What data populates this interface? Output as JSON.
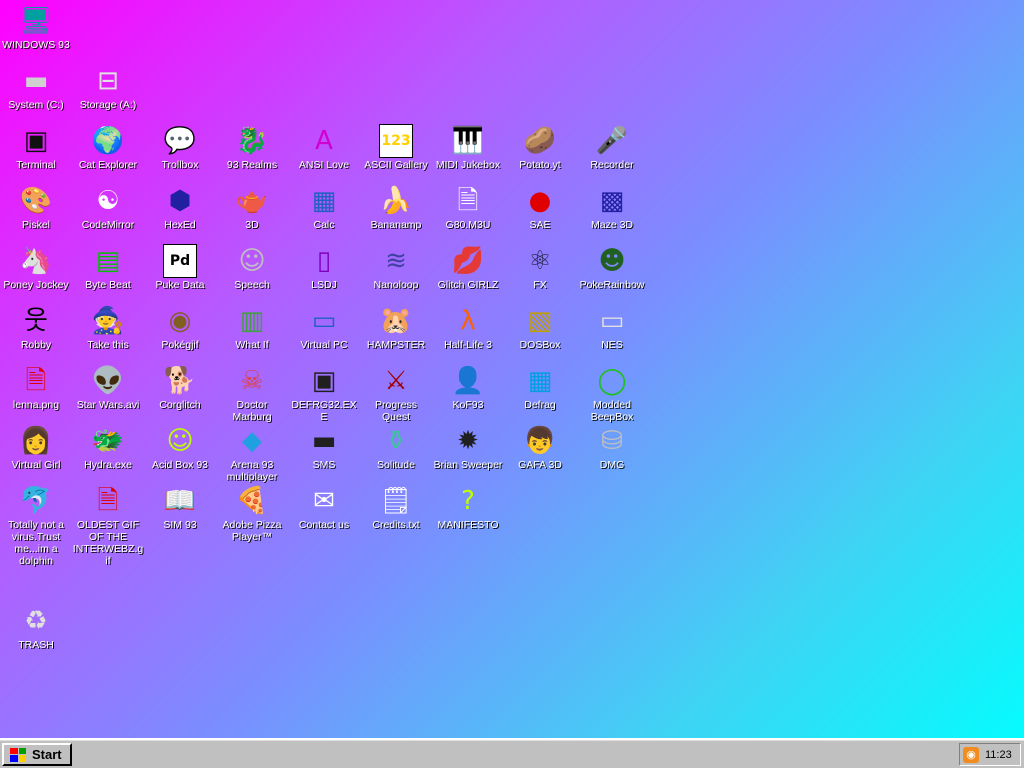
{
  "desktop": {
    "icons": [
      {
        "label": "WINDOWS 93",
        "icon": "computer-icon",
        "glyph": "🖥",
        "color": "#00a0a0"
      },
      {
        "label": "System (C:)",
        "icon": "hard-drive-icon",
        "glyph": "▬",
        "color": "#d0d0d0"
      },
      {
        "label": "Storage (A:)",
        "icon": "floppy-drive-icon",
        "glyph": "⊟",
        "color": "#e0e0e0"
      },
      {
        "label": "Terminal",
        "icon": "terminal-icon",
        "glyph": "▣",
        "color": "#111111"
      },
      {
        "label": "Cat Explorer",
        "icon": "cat-globe-icon",
        "glyph": "🌍",
        "color": "#3a8a3a"
      },
      {
        "label": "Trollbox",
        "icon": "chat-bubble-icon",
        "glyph": "💬",
        "color": "#2ab4ff"
      },
      {
        "label": "93 Realms",
        "icon": "dragon-icon",
        "glyph": "🐉",
        "color": "#d01010"
      },
      {
        "label": "ANSI Love",
        "icon": "ansi-letter-icon",
        "glyph": "A",
        "color": "#d000d0"
      },
      {
        "label": "ASCII Gallery",
        "icon": "number-blocks-icon",
        "glyph": "123",
        "color": "#ffd000"
      },
      {
        "label": "MIDI Jukebox",
        "icon": "piano-keys-icon",
        "glyph": "🎹",
        "color": "#222222"
      },
      {
        "label": "Potato.yt",
        "icon": "potato-icon",
        "glyph": "🥔",
        "color": "#b07030"
      },
      {
        "label": "Recorder",
        "icon": "microphone-icon",
        "glyph": "🎤",
        "color": "#333333"
      },
      {
        "label": "Piskel",
        "icon": "paint-palette-icon",
        "glyph": "🎨",
        "color": "#d0a050"
      },
      {
        "label": "CodeMirror",
        "icon": "code-mirror-icon",
        "glyph": "☯",
        "color": "#ffffff"
      },
      {
        "label": "HexEd",
        "icon": "hex-cube-icon",
        "glyph": "⬢",
        "color": "#2020a0"
      },
      {
        "label": "3D",
        "icon": "teapot-icon",
        "glyph": "🫖",
        "color": "#ff80a0"
      },
      {
        "label": "Calc",
        "icon": "calculator-icon",
        "glyph": "▦",
        "color": "#2060c0"
      },
      {
        "label": "Bananamp",
        "icon": "banana-icon",
        "glyph": "🍌",
        "color": "#ffe000"
      },
      {
        "label": "G80.M3U",
        "icon": "music-file-icon",
        "glyph": "🗎",
        "color": "#ffffff"
      },
      {
        "label": "SAE",
        "icon": "checkered-ball-icon",
        "glyph": "●",
        "color": "#e00000"
      },
      {
        "label": "Maze 3D",
        "icon": "maze-icon",
        "glyph": "▩",
        "color": "#2020a0"
      },
      {
        "label": "Poney Jockey",
        "icon": "pony-icon",
        "glyph": "🦄",
        "color": "#c080ff"
      },
      {
        "label": "Byte Beat",
        "icon": "waveform-icon",
        "glyph": "▤",
        "color": "#00c000"
      },
      {
        "label": "Puke Data",
        "icon": "pd-patch-icon",
        "glyph": "Pd",
        "color": "#000000"
      },
      {
        "label": "Speech",
        "icon": "face-speech-icon",
        "glyph": "☺",
        "color": "#c0c0c0"
      },
      {
        "label": "LSDJ",
        "icon": "gameboy-icon",
        "glyph": "▯",
        "color": "#8000c0"
      },
      {
        "label": "Nanoloop",
        "icon": "sine-wave-icon",
        "glyph": "≋",
        "color": "#4040a0"
      },
      {
        "label": "Glitch GIRLZ",
        "icon": "lips-icon",
        "glyph": "💋",
        "color": "#e00040"
      },
      {
        "label": "FX",
        "icon": "atom-icon",
        "glyph": "⚛",
        "color": "#202040"
      },
      {
        "label": "PokeRainbow",
        "icon": "pokemon-group-icon",
        "glyph": "☻",
        "color": "#206020"
      },
      {
        "label": "Robby",
        "icon": "stick-figure-icon",
        "glyph": "웃",
        "color": "#000000"
      },
      {
        "label": "Take this",
        "icon": "pixel-character-icon",
        "glyph": "🧙",
        "color": "#ff6000"
      },
      {
        "label": "Pokégjif",
        "icon": "pokemon-ball-icon",
        "glyph": "◉",
        "color": "#806020"
      },
      {
        "label": "What If",
        "icon": "film-strip-icon",
        "glyph": "▥",
        "color": "#40a040"
      },
      {
        "label": "Virtual PC",
        "icon": "virtual-pc-window-icon",
        "glyph": "▭",
        "color": "#2060c0"
      },
      {
        "label": "HAMPSTER",
        "icon": "hamster-icon",
        "glyph": "🐹",
        "color": "#f0f0f0"
      },
      {
        "label": "Half-Life 3",
        "icon": "lambda-icon",
        "glyph": "λ",
        "color": "#ff6000"
      },
      {
        "label": "DOSBox",
        "icon": "dosbox-icon",
        "glyph": "▧",
        "color": "#c0a000"
      },
      {
        "label": "NES",
        "icon": "nes-console-icon",
        "glyph": "▭",
        "color": "#e0e0e0"
      },
      {
        "label": "lenna.png",
        "icon": "image-file-icon",
        "glyph": "🗎",
        "color": "#e00000"
      },
      {
        "label": "Star Wars.avi",
        "icon": "yoda-icon",
        "glyph": "👽",
        "color": "#40a020"
      },
      {
        "label": "Corglitch",
        "icon": "corgi-icon",
        "glyph": "🐕",
        "color": "#e08040"
      },
      {
        "label": "Doctor Marburg",
        "icon": "doctor-icon",
        "glyph": "☠",
        "color": "#e04040"
      },
      {
        "label": "DEFRG32.EXE",
        "icon": "defrag-robot-icon",
        "glyph": "▣",
        "color": "#202020"
      },
      {
        "label": "Progress Quest",
        "icon": "crossed-swords-icon",
        "glyph": "⚔",
        "color": "#a00000"
      },
      {
        "label": "KoF93",
        "icon": "fighter-portrait-icon",
        "glyph": "👤",
        "color": "#c06040"
      },
      {
        "label": "Defrag",
        "icon": "defrag-blocks-icon",
        "glyph": "▦",
        "color": "#00a0e0"
      },
      {
        "label": "Modded BeepBox",
        "icon": "green-ring-icon",
        "glyph": "◯",
        "color": "#20c020"
      },
      {
        "label": "Virtual Girl",
        "icon": "face-portrait-icon",
        "glyph": "👩",
        "color": "#e0a080"
      },
      {
        "label": "Hydra.exe",
        "icon": "hydra-icon",
        "glyph": "🐲",
        "color": "#208020"
      },
      {
        "label": "Acid Box 93",
        "icon": "smiley-icon",
        "glyph": "☺",
        "color": "#c0ff00"
      },
      {
        "label": "Arena 93 multiplayer",
        "icon": "cube-icon",
        "glyph": "◆",
        "color": "#20a0e0"
      },
      {
        "label": "SMS",
        "icon": "sms-console-icon",
        "glyph": "▬",
        "color": "#202020"
      },
      {
        "label": "Solitude",
        "icon": "bottle-icon",
        "glyph": "⚱",
        "color": "#40c0a0"
      },
      {
        "label": "Brian Sweeper",
        "icon": "mine-icon",
        "glyph": "✹",
        "color": "#202020"
      },
      {
        "label": "GAFA 3D",
        "icon": "face-3d-icon",
        "glyph": "👦",
        "color": "#c06020"
      },
      {
        "label": "DMG",
        "icon": "disk-image-icon",
        "glyph": "⛁",
        "color": "#c0c0c0"
      },
      {
        "label": "Totally not a virus.Trust me...im a dolphin",
        "icon": "dolphin-icon",
        "glyph": "🐬",
        "color": "#2060a0"
      },
      {
        "label": "OLDEST GIF OF THE INTERWEBZ.gif",
        "icon": "gif-file-icon",
        "glyph": "🗎",
        "color": "#e00000"
      },
      {
        "label": "SIM 93",
        "icon": "book-icon",
        "glyph": "📖",
        "color": "#ffffff"
      },
      {
        "label": "Adobe Pizza Player™",
        "icon": "pizza-icon",
        "glyph": "🍕",
        "color": "#e08020"
      },
      {
        "label": "Contact us",
        "icon": "mail-icon",
        "glyph": "✉",
        "color": "#ffffff"
      },
      {
        "label": "Credits.txt",
        "icon": "text-file-icon",
        "glyph": "🗒",
        "color": "#ffffff"
      },
      {
        "label": "MANIFESTO",
        "icon": "question-mark-icon",
        "glyph": "?",
        "color": "#c0ff00"
      },
      {
        "label": "TRASH",
        "icon": "recycle-bin-icon",
        "glyph": "♻",
        "color": "#e0e0e0"
      }
    ]
  },
  "taskbar": {
    "start_label": "Start",
    "clock": "11:23",
    "rss_icon": "rss-icon"
  }
}
